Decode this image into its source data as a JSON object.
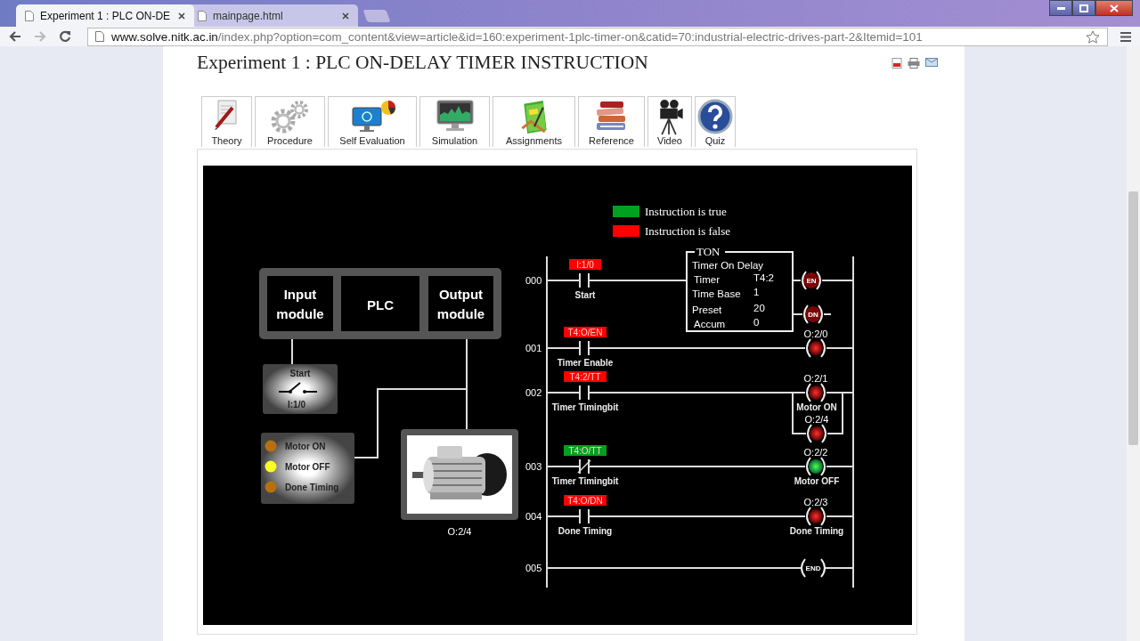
{
  "browser": {
    "tabs": [
      {
        "title": "Experiment 1 : PLC ON-DE",
        "selected": true
      },
      {
        "title": "mainpage.html",
        "selected": false
      }
    ],
    "url": {
      "domain": "www.solve.nitk.ac.in",
      "path": "/index.php?option=com_content&view=article&id=160:experiment-1plc-timer-on&catid=70:industrial-electric-drives-part-2&Itemid=101"
    }
  },
  "page": {
    "title": "Experiment 1 : PLC ON-DELAY TIMER INSTRUCTION",
    "nav": [
      {
        "label": "Theory"
      },
      {
        "label": "Procedure"
      },
      {
        "label": "Self Evaluation"
      },
      {
        "label": "Simulation"
      },
      {
        "label": "Assignments"
      },
      {
        "label": "Reference"
      },
      {
        "label": "Video"
      },
      {
        "label": "Quiz"
      }
    ]
  },
  "simulation": {
    "legend": [
      {
        "label": "Instruction is true",
        "color": "#00a020"
      },
      {
        "label": "Instruction is false",
        "color": "#ff0000"
      }
    ],
    "modules": [
      {
        "lines": [
          "Input",
          "module"
        ]
      },
      {
        "lines": [
          "PLC"
        ]
      },
      {
        "lines": [
          "Output",
          "module"
        ]
      }
    ],
    "start_switch": {
      "label": "Start",
      "address": "I:1/0"
    },
    "indicators": [
      {
        "label": "Motor ON",
        "on": false
      },
      {
        "label": "Motor OFF",
        "on": true
      },
      {
        "label": "Done Timing",
        "on": false
      }
    ],
    "motor": {
      "address": "O:2/4"
    },
    "rungs": [
      {
        "number": "000",
        "contact": {
          "address": "I:1/0",
          "label": "Start",
          "kind": "no",
          "energized": false
        },
        "block": {
          "title": "TON",
          "heading": "Timer On Delay",
          "fields": [
            {
              "name": "Timer",
              "value": "T4:2"
            },
            {
              "name": "Time Base",
              "value": "1"
            },
            {
              "name": "Preset",
              "value": "20"
            },
            {
              "name": "Accum",
              "value": "0"
            }
          ]
        },
        "coils": [
          {
            "kind": "bit",
            "text": "EN",
            "energized": false
          },
          {
            "kind": "bit",
            "text": "DN",
            "energized": false
          }
        ]
      },
      {
        "number": "001",
        "contact": {
          "address": "T4:O/EN",
          "label": "Timer Enable",
          "kind": "no",
          "energized": false
        },
        "coils": [
          {
            "kind": "lamp",
            "address": "O:2/0",
            "energized": false
          }
        ]
      },
      {
        "number": "002",
        "contact": {
          "address": "T4:2/TT",
          "label": "Timer Timingbit",
          "kind": "no",
          "energized": false
        },
        "coils": [
          {
            "kind": "lamp",
            "address": "O:2/1",
            "label": "Motor ON",
            "energized": false
          },
          {
            "kind": "lamp",
            "address": "O:2/4",
            "energized": false
          }
        ]
      },
      {
        "number": "003",
        "contact": {
          "address": "T4:O/TT",
          "label": "Timer Timingbit",
          "kind": "nc",
          "energized": true
        },
        "coils": [
          {
            "kind": "lamp",
            "address": "O:2/2",
            "label": "Motor OFF",
            "energized": true
          }
        ]
      },
      {
        "number": "004",
        "contact": {
          "address": "T4:O/DN",
          "label": "Done Timing",
          "kind": "no",
          "energized": false
        },
        "coils": [
          {
            "kind": "lamp",
            "address": "O:2/3",
            "label": "Done Timing",
            "energized": false
          }
        ]
      },
      {
        "number": "005",
        "coils": [
          {
            "kind": "end",
            "text": "END"
          }
        ]
      }
    ]
  }
}
